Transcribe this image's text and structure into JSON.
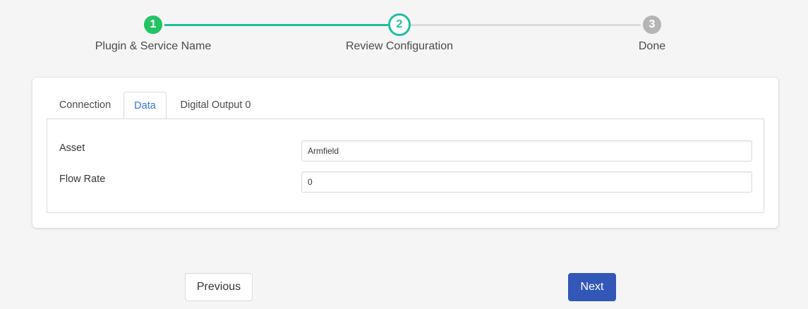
{
  "stepper": {
    "steps": [
      {
        "number": "1",
        "label": "Plugin & Service Name",
        "status": "completed"
      },
      {
        "number": "2",
        "label": "Review Configuration",
        "status": "current"
      },
      {
        "number": "3",
        "label": "Done",
        "status": "pending"
      }
    ],
    "colors": {
      "completed": "#23c464",
      "current": "#1fbfa0",
      "pending": "#b5b5b5"
    }
  },
  "tabs": [
    {
      "label": "Connection",
      "active": false
    },
    {
      "label": "Data",
      "active": true
    },
    {
      "label": "Digital Output 0",
      "active": false
    }
  ],
  "fields": [
    {
      "label": "Asset",
      "value": "Armfield"
    },
    {
      "label": "Flow Rate",
      "value": "0"
    }
  ],
  "buttons": {
    "previous": "Previous",
    "next": "Next"
  },
  "colors": {
    "accent": "#3273dc",
    "primary_button": "#3257b6"
  }
}
